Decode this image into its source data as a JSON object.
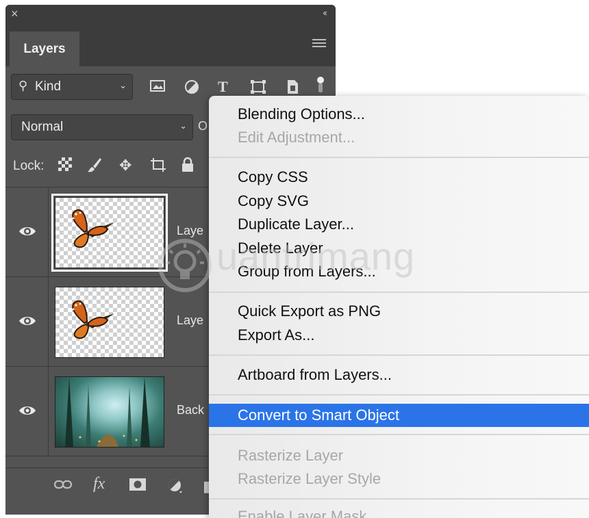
{
  "panel": {
    "close_glyph": "×",
    "collapse_glyph": "‹‹",
    "tab_label": "Layers",
    "filter": {
      "label": "Kind",
      "icon": "search-icon"
    },
    "filter_icons": [
      "image-filter-icon",
      "adjustment-filter-icon",
      "type-filter-icon",
      "shape-filter-icon",
      "smart-object-filter-icon"
    ],
    "blend_mode": "Normal",
    "opacity_label": "O",
    "lock_label": "Lock:",
    "lock_icons": [
      "lock-transparent-icon",
      "lock-image-icon",
      "lock-position-icon",
      "lock-artboard-icon",
      "lock-all-icon"
    ],
    "layers": [
      {
        "name": "Laye",
        "thumb": "butterfly",
        "selected": true
      },
      {
        "name": "Laye",
        "thumb": "butterfly",
        "selected": false
      },
      {
        "name": "Back",
        "thumb": "forest",
        "selected": false
      }
    ],
    "bottom_icons": [
      "link-layers-icon",
      "fx-icon",
      "mask-icon",
      "adjustment-layer-icon"
    ],
    "bottom_fx": "fx"
  },
  "context_menu": {
    "items": [
      {
        "label": "Blending Options...",
        "enabled": true
      },
      {
        "label": "Edit Adjustment...",
        "enabled": false
      },
      {
        "label": "Copy CSS",
        "enabled": true
      },
      {
        "label": "Copy SVG",
        "enabled": true
      },
      {
        "label": "Duplicate Layer...",
        "enabled": true
      },
      {
        "label": "Delete Layer",
        "enabled": true
      },
      {
        "label": "Group from Layers...",
        "enabled": true
      },
      {
        "label": "Quick Export as PNG",
        "enabled": true
      },
      {
        "label": "Export As...",
        "enabled": true
      },
      {
        "label": "Artboard from Layers...",
        "enabled": true
      },
      {
        "label": "Convert to Smart Object",
        "enabled": true,
        "highlighted": true
      },
      {
        "label": "Rasterize Layer",
        "enabled": false
      },
      {
        "label": "Rasterize Layer Style",
        "enabled": false
      },
      {
        "label": "Enable Layer Mask",
        "enabled": false
      }
    ],
    "highlight_color": "#2b74e8"
  },
  "watermark": {
    "text": "uantrimang"
  }
}
